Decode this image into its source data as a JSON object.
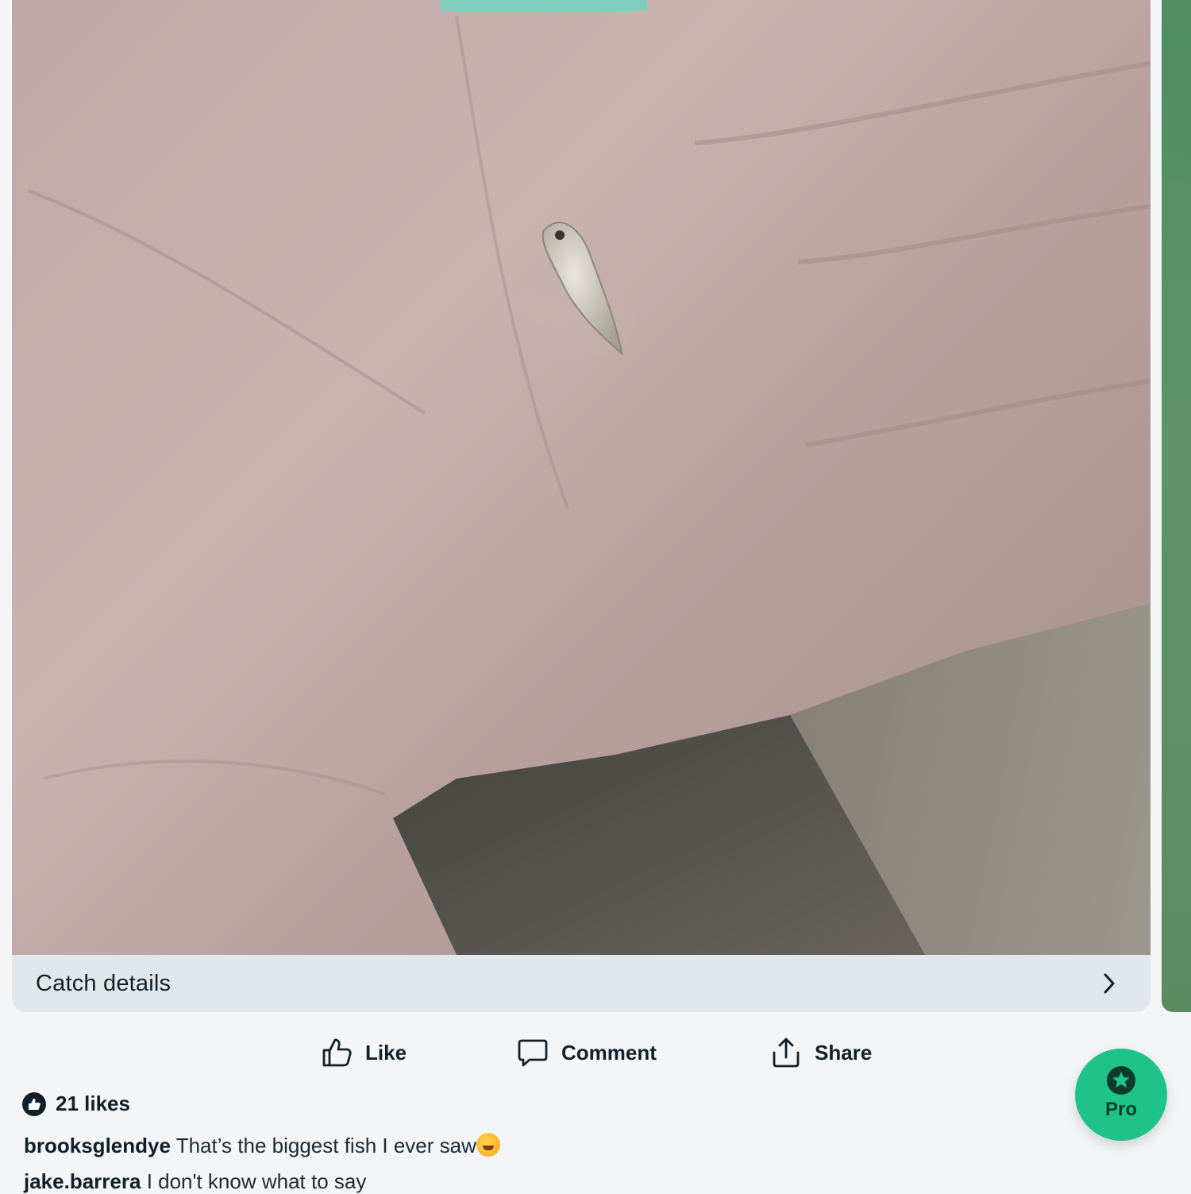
{
  "post": {
    "image_alt": "Tiny fish held in an open palm over sand",
    "catch_details_label": "Catch details"
  },
  "actions": {
    "like_label": "Like",
    "comment_label": "Comment",
    "share_label": "Share"
  },
  "likes": {
    "text": "21 likes"
  },
  "comments": [
    {
      "user": "brooksglendye",
      "text": "That’s the biggest fish I ever saw"
    },
    {
      "user": "jake.barrera",
      "text": "I don't know what to say"
    }
  ],
  "pro_button": {
    "label": "Pro"
  },
  "icons": {
    "catch_details": "chevron-right-icon",
    "like": "thumbs-up-icon",
    "comment": "speech-bubble-icon",
    "share": "share-upload-icon",
    "likes": "thumbs-up-badge-icon",
    "pro": "star-badge-icon",
    "emoji": "rolling-laughing-emoji"
  },
  "colors": {
    "accent": "#1fc38a",
    "text": "#10202b",
    "background": "#f3f5f7",
    "card_footer": "#e2e7ec"
  }
}
